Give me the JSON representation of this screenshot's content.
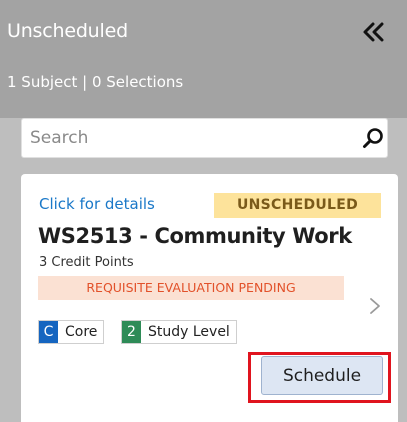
{
  "panel": {
    "title": "Unscheduled",
    "summary": "1 Subject | 0 Selections",
    "collapse_icon": "double-chevron-left-icon"
  },
  "search": {
    "placeholder": "Search",
    "value": "",
    "icon": "search-icon"
  },
  "card": {
    "details_link": "Click for details",
    "status": "UNSCHEDULED",
    "title": "WS2513 - Community Work",
    "credits": "3 Credit Points",
    "requisite": "REQUISITE EVALUATION PENDING",
    "tags": [
      {
        "code": "C",
        "label": "Core",
        "color": "#1565c0"
      },
      {
        "code": "2",
        "label": "Study Level",
        "color": "#2e8b57"
      }
    ],
    "schedule_label": "Schedule",
    "expand_icon": "chevron-right-icon"
  },
  "colors": {
    "header": "#a3a3a3",
    "body": "#bebebe",
    "link": "#1a78c8",
    "status_bg": "#fde39b",
    "requisite_bg": "#fbe1d3",
    "requisite_text": "#e2512a",
    "highlight": "#e0141e"
  }
}
